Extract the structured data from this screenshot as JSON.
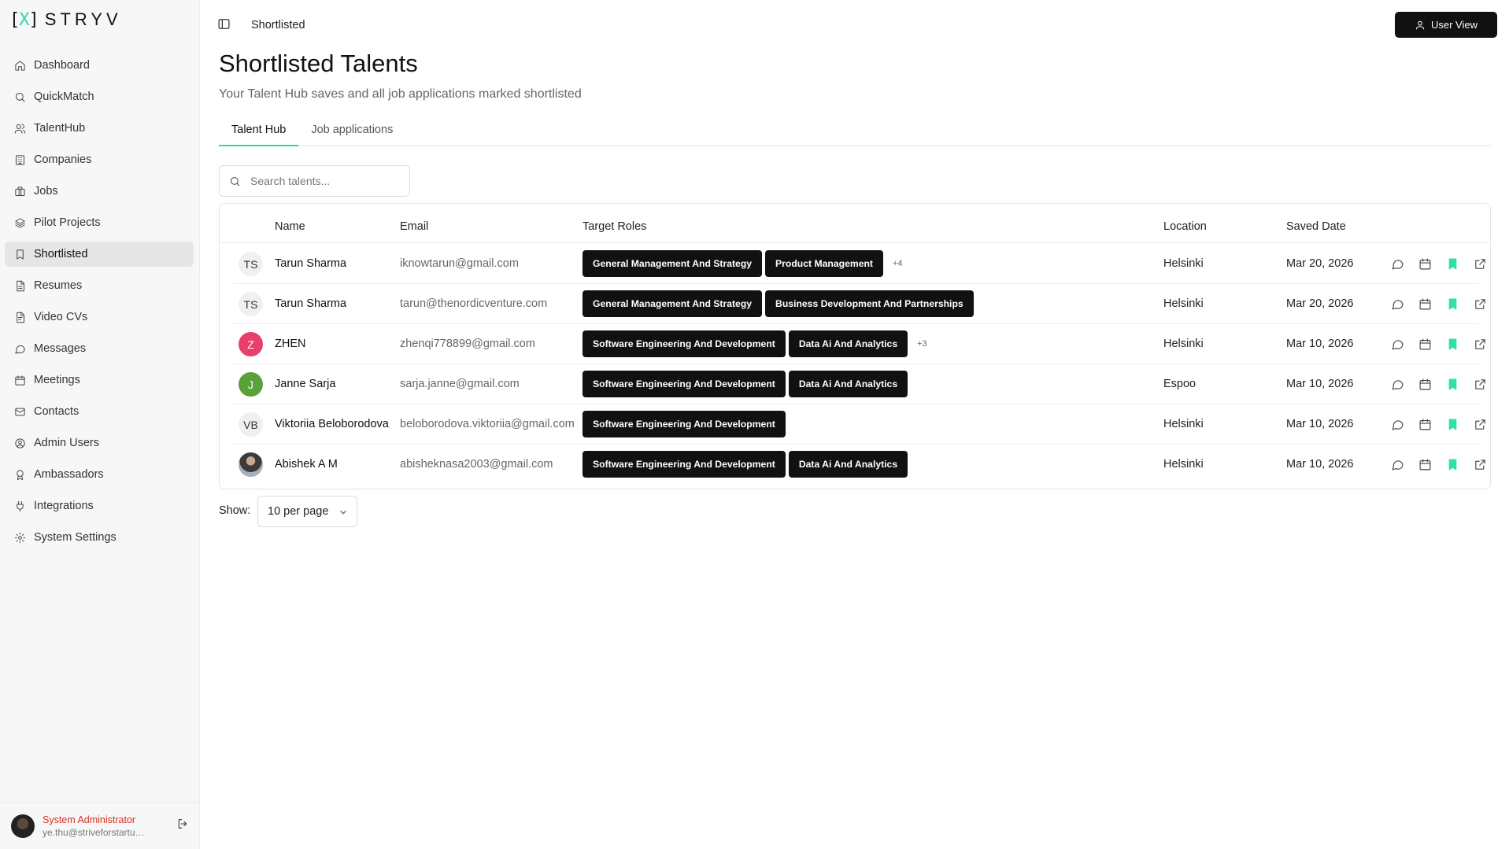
{
  "brand": {
    "mark_left": "[",
    "mark_x": "X",
    "mark_right": "]",
    "name": "STRYV",
    "accent": "#2fd6b4"
  },
  "sidebar": {
    "items": [
      {
        "label": "Dashboard",
        "icon": "home-icon"
      },
      {
        "label": "QuickMatch",
        "icon": "search-icon"
      },
      {
        "label": "TalentHub",
        "icon": "users-icon"
      },
      {
        "label": "Companies",
        "icon": "building-icon"
      },
      {
        "label": "Jobs",
        "icon": "briefcase-icon"
      },
      {
        "label": "Pilot Projects",
        "icon": "layers-icon"
      },
      {
        "label": "Shortlisted",
        "icon": "bookmark-icon",
        "active": true
      },
      {
        "label": "Resumes",
        "icon": "file-icon"
      },
      {
        "label": "Video CVs",
        "icon": "file-video-icon"
      },
      {
        "label": "Messages",
        "icon": "message-icon"
      },
      {
        "label": "Meetings",
        "icon": "calendar-icon"
      },
      {
        "label": "Contacts",
        "icon": "mail-icon"
      },
      {
        "label": "Admin Users",
        "icon": "user-circle-icon"
      },
      {
        "label": "Ambassadors",
        "icon": "award-icon"
      },
      {
        "label": "Integrations",
        "icon": "plug-icon"
      },
      {
        "label": "System Settings",
        "icon": "gear-icon"
      }
    ],
    "user": {
      "name": "System Administrator",
      "email": "ye.thu@striveforstartups.com"
    }
  },
  "header": {
    "breadcrumb": "Shortlisted",
    "user_view_label": "User View"
  },
  "page": {
    "title": "Shortlisted Talents",
    "subtitle": "Your Talent Hub saves and all job applications marked shortlisted"
  },
  "tabs": [
    {
      "label": "Talent Hub",
      "active": true
    },
    {
      "label": "Job applications",
      "active": false
    }
  ],
  "search": {
    "placeholder": "Search talents..."
  },
  "table": {
    "columns": [
      "Name",
      "Email",
      "Target Roles",
      "Location",
      "Saved Date"
    ],
    "rows": [
      {
        "initials": "TS",
        "avatar": "plain",
        "name": "Tarun Sharma",
        "email": "iknowtarun@gmail.com",
        "roles": [
          "General Management And Strategy",
          "Product Management"
        ],
        "more": "+4",
        "location": "Helsinki",
        "date": "Mar 20, 2026"
      },
      {
        "initials": "TS",
        "avatar": "plain",
        "name": "Tarun Sharma",
        "email": "tarun@thenordicventure.com",
        "roles": [
          "General Management And Strategy",
          "Business Development And Partnerships"
        ],
        "more": "",
        "location": "Helsinki",
        "date": "Mar 20, 2026"
      },
      {
        "initials": "Z",
        "avatar": "pink",
        "name": "ZHEN",
        "email": "zhenqi778899@gmail.com",
        "roles": [
          "Software Engineering And Development",
          "Data Ai And Analytics"
        ],
        "more": "+3",
        "location": "Helsinki",
        "date": "Mar 10, 2026"
      },
      {
        "initials": "J",
        "avatar": "green",
        "name": "Janne Sarja",
        "email": "sarja.janne@gmail.com",
        "roles": [
          "Software Engineering And Development",
          "Data Ai And Analytics"
        ],
        "more": "",
        "location": "Espoo",
        "date": "Mar 10, 2026"
      },
      {
        "initials": "VB",
        "avatar": "plain",
        "name": "Viktoriia Beloborodova",
        "email": "beloborodova.viktoriia@gmail.com",
        "roles": [
          "Software Engineering And Development"
        ],
        "more": "",
        "location": "Helsinki",
        "date": "Mar 10, 2026"
      },
      {
        "initials": "",
        "avatar": "photo",
        "name": "Abishek A M",
        "email": "abisheknasa2003@gmail.com",
        "roles": [
          "Software Engineering And Development",
          "Data Ai And Analytics"
        ],
        "more": "",
        "location": "Helsinki",
        "date": "Mar 10, 2026"
      }
    ]
  },
  "pagination": {
    "show_label": "Show:",
    "per_page": "10 per page"
  },
  "colors": {
    "accent": "#2fd6b4",
    "bookmark": "#2fe0a8",
    "admin_name": "#d93025",
    "chip_bg": "#111111"
  }
}
